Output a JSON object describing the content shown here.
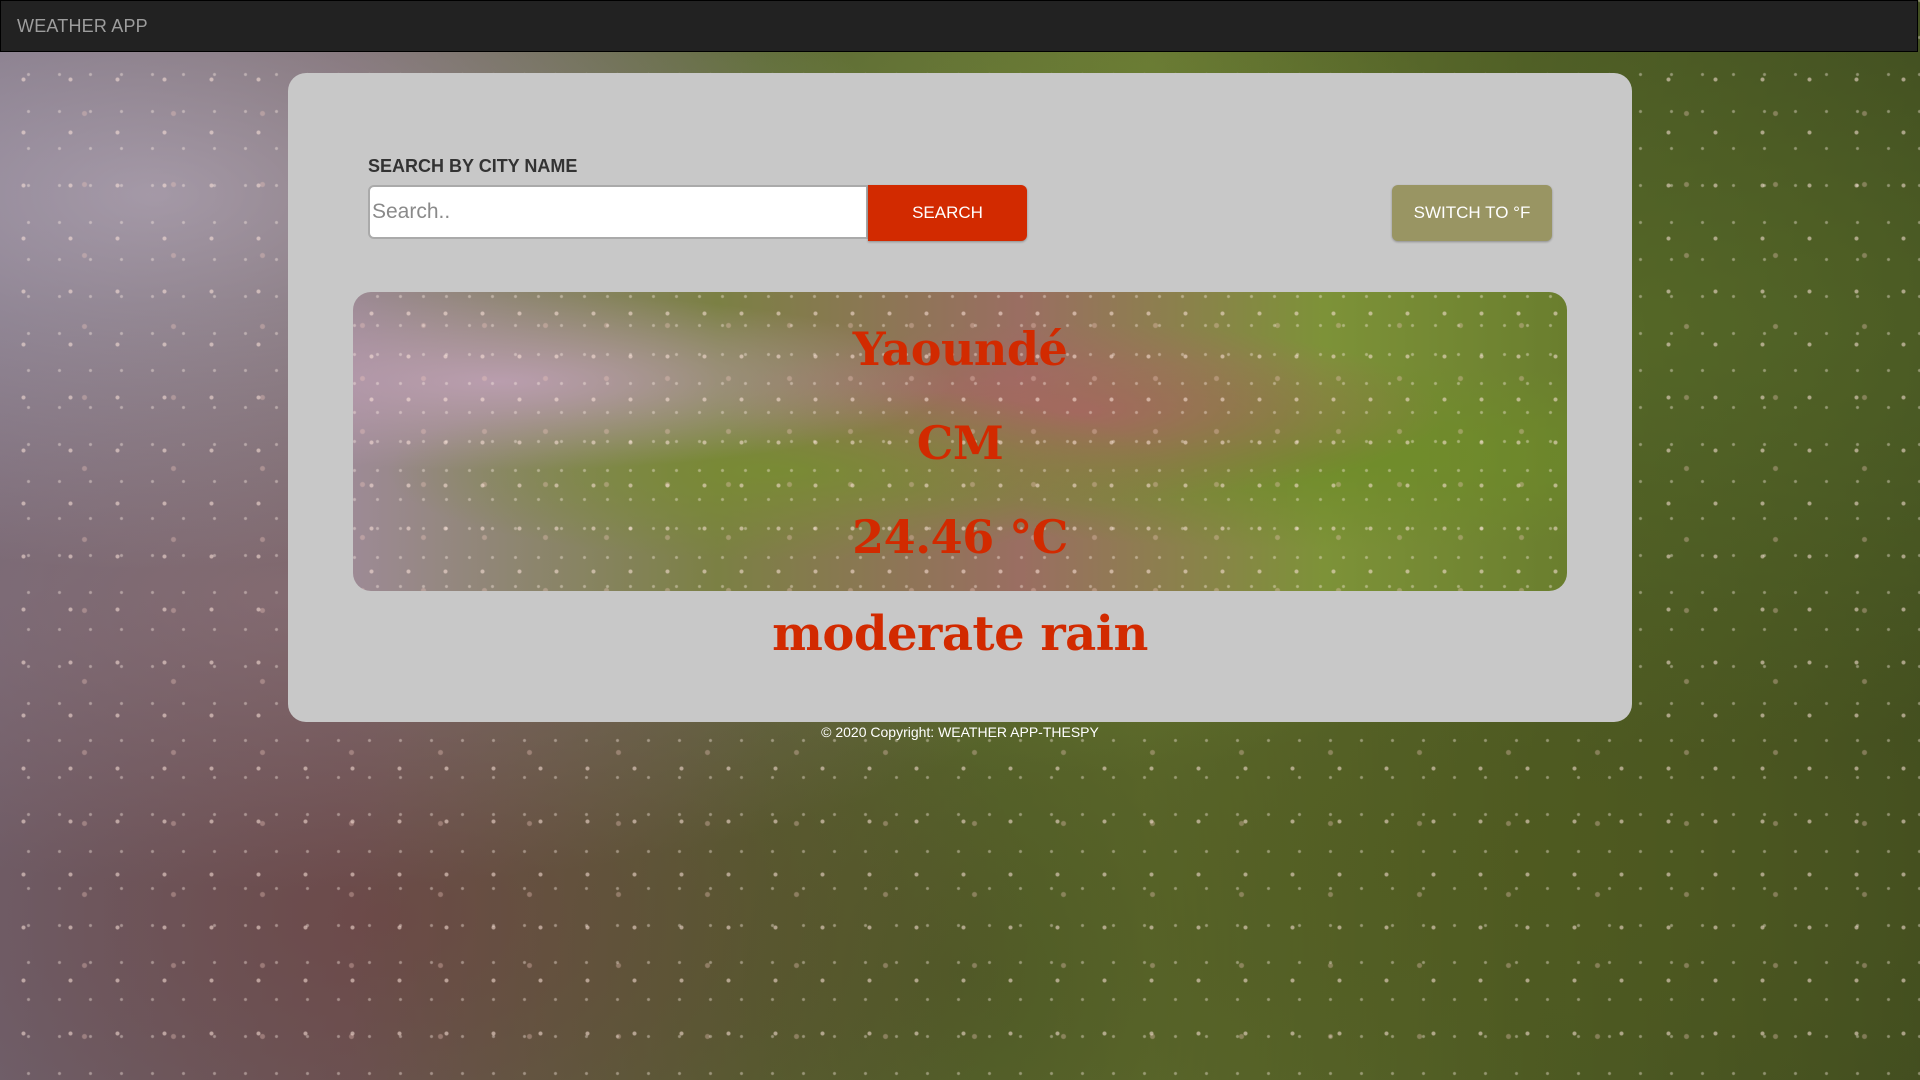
{
  "navbar": {
    "brand": "WEATHER APP"
  },
  "search": {
    "label": "SEARCH BY CITY NAME",
    "placeholder": "Search..",
    "value": "",
    "button_label": "SEARCH"
  },
  "unit_toggle": {
    "label": "SWITCH TO °F"
  },
  "weather": {
    "city": "Yaoundé",
    "country": "CM",
    "temperature": "24.46 °C",
    "description": "moderate rain"
  },
  "footer": {
    "copyright": "© 2020 Copyright: WEATHER APP-THESPY"
  },
  "colors": {
    "accent": "#d22a00",
    "toggle": "#999563",
    "navbar": "#222222",
    "card": "#c8c8c8"
  }
}
